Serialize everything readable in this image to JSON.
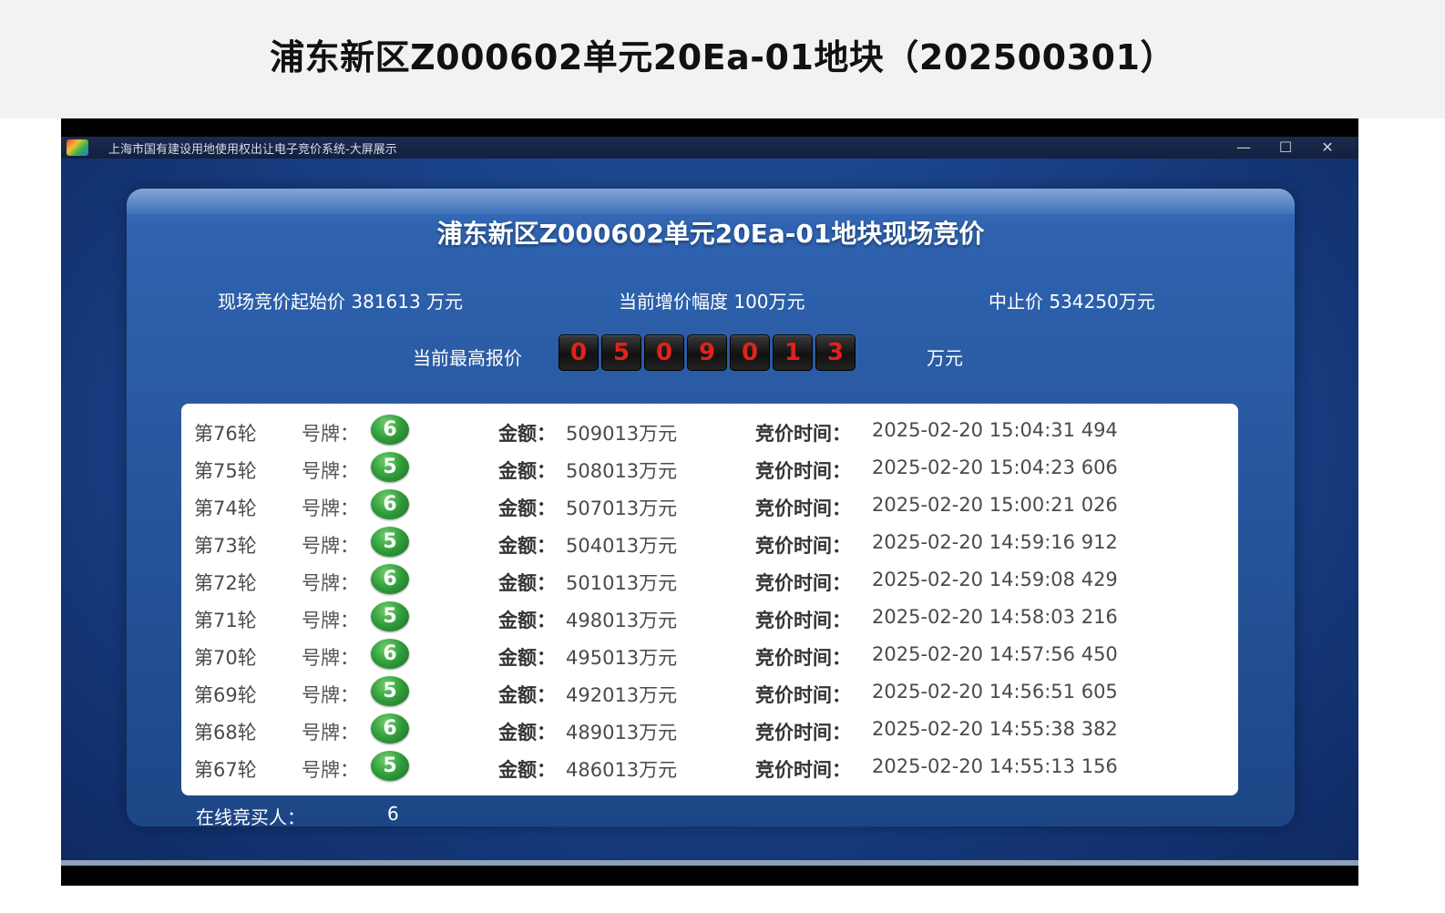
{
  "article": {
    "headline": "浦东新区Z000602单元20Ea-01地块（202500301）"
  },
  "window": {
    "title": "上海市国有建设用地使用权出让电子竞价系统-大屏展示",
    "minimize": "—",
    "maximize": "☐",
    "close": "✕"
  },
  "auction": {
    "title": "浦东新区Z000602单元20Ea-01地块现场竞价",
    "start_price": "现场竞价起始价 381613 万元",
    "increment": "当前增价幅度 100万元",
    "cap_price": "中止价 534250万元",
    "current_label": "当前最高报价",
    "current_digits": [
      "0",
      "5",
      "0",
      "9",
      "0",
      "1",
      "3"
    ],
    "current_unit": "万元",
    "online_label": "在线竞买人：",
    "online_count": "6"
  },
  "labels": {
    "plate": "号牌：",
    "amount": "金额：",
    "time": "竞价时间："
  },
  "bids": [
    {
      "round": "第76轮",
      "plate": "6",
      "amount": "509013万元",
      "time": "2025-02-20 15:04:31 494"
    },
    {
      "round": "第75轮",
      "plate": "5",
      "amount": "508013万元",
      "time": "2025-02-20 15:04:23 606"
    },
    {
      "round": "第74轮",
      "plate": "6",
      "amount": "507013万元",
      "time": "2025-02-20 15:00:21 026"
    },
    {
      "round": "第73轮",
      "plate": "5",
      "amount": "504013万元",
      "time": "2025-02-20 14:59:16 912"
    },
    {
      "round": "第72轮",
      "plate": "6",
      "amount": "501013万元",
      "time": "2025-02-20 14:59:08 429"
    },
    {
      "round": "第71轮",
      "plate": "5",
      "amount": "498013万元",
      "time": "2025-02-20 14:58:03 216"
    },
    {
      "round": "第70轮",
      "plate": "6",
      "amount": "495013万元",
      "time": "2025-02-20 14:57:56 450"
    },
    {
      "round": "第69轮",
      "plate": "5",
      "amount": "492013万元",
      "time": "2025-02-20 14:56:51 605"
    },
    {
      "round": "第68轮",
      "plate": "6",
      "amount": "489013万元",
      "time": "2025-02-20 14:55:38 382"
    },
    {
      "round": "第67轮",
      "plate": "5",
      "amount": "486013万元",
      "time": "2025-02-20 14:55:13 156"
    }
  ]
}
